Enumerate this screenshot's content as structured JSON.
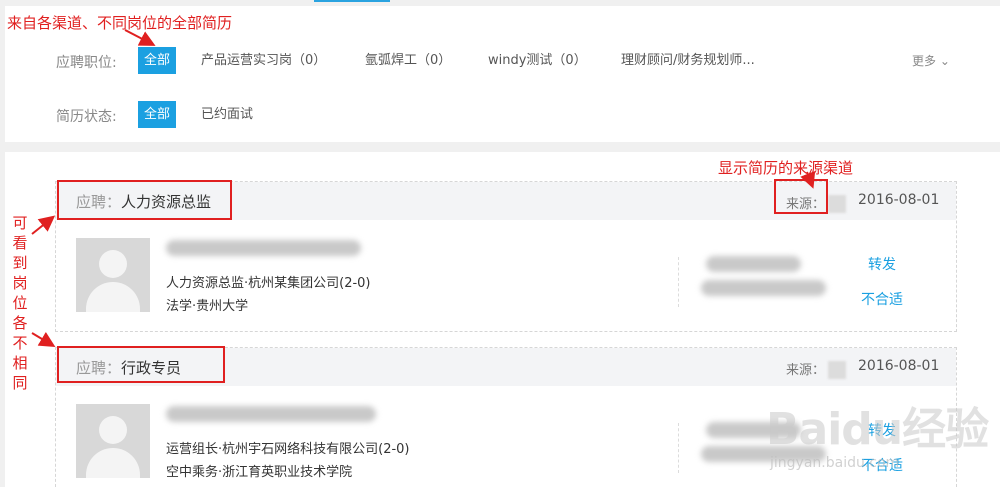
{
  "filters": {
    "position_label": "应聘职位:",
    "position_options": [
      {
        "label": "全部",
        "active": true
      },
      {
        "label": "产品运营实习岗（0）"
      },
      {
        "label": "氩弧焊工（0）"
      },
      {
        "label": "windy测试（0）"
      },
      {
        "label": "理财顾问/财务规划师..."
      }
    ],
    "more_label": "更多",
    "status_label": "简历状态:",
    "status_options": [
      {
        "label": "全部",
        "active": true
      },
      {
        "label": "已约面试"
      }
    ]
  },
  "resumes": [
    {
      "apply_prefix": "应聘：",
      "position": "人力资源总监",
      "source_label": "来源：",
      "date": "2016-08-01",
      "job_line": "人力资源总监·杭州某集团公司(2-0)",
      "edu_line": "法学·贵州大学",
      "forward_label": "转发",
      "reject_label": "不合适"
    },
    {
      "apply_prefix": "应聘：",
      "position": "行政专员",
      "source_label": "来源：",
      "date": "2016-08-01",
      "job_line": "运营组长·杭州宇石网络科技有限公司(2-0)",
      "edu_line": "空中乘务·浙江育英职业技术学院",
      "forward_label": "转发",
      "reject_label": "不合适"
    }
  ],
  "annotations": {
    "all_channels": "来自各渠道、不同岗位的全部简历",
    "source_channel": "显示简历的来源渠道",
    "vertical_chars": [
      "可",
      "看",
      "到",
      "岗",
      "位",
      "各",
      "不",
      "相",
      "同"
    ]
  },
  "watermark": {
    "main": "Baidu经验",
    "sub": "jingyan.baidu.com"
  },
  "colors": {
    "accent": "#1ba0e1",
    "annotation": "#e02020"
  }
}
